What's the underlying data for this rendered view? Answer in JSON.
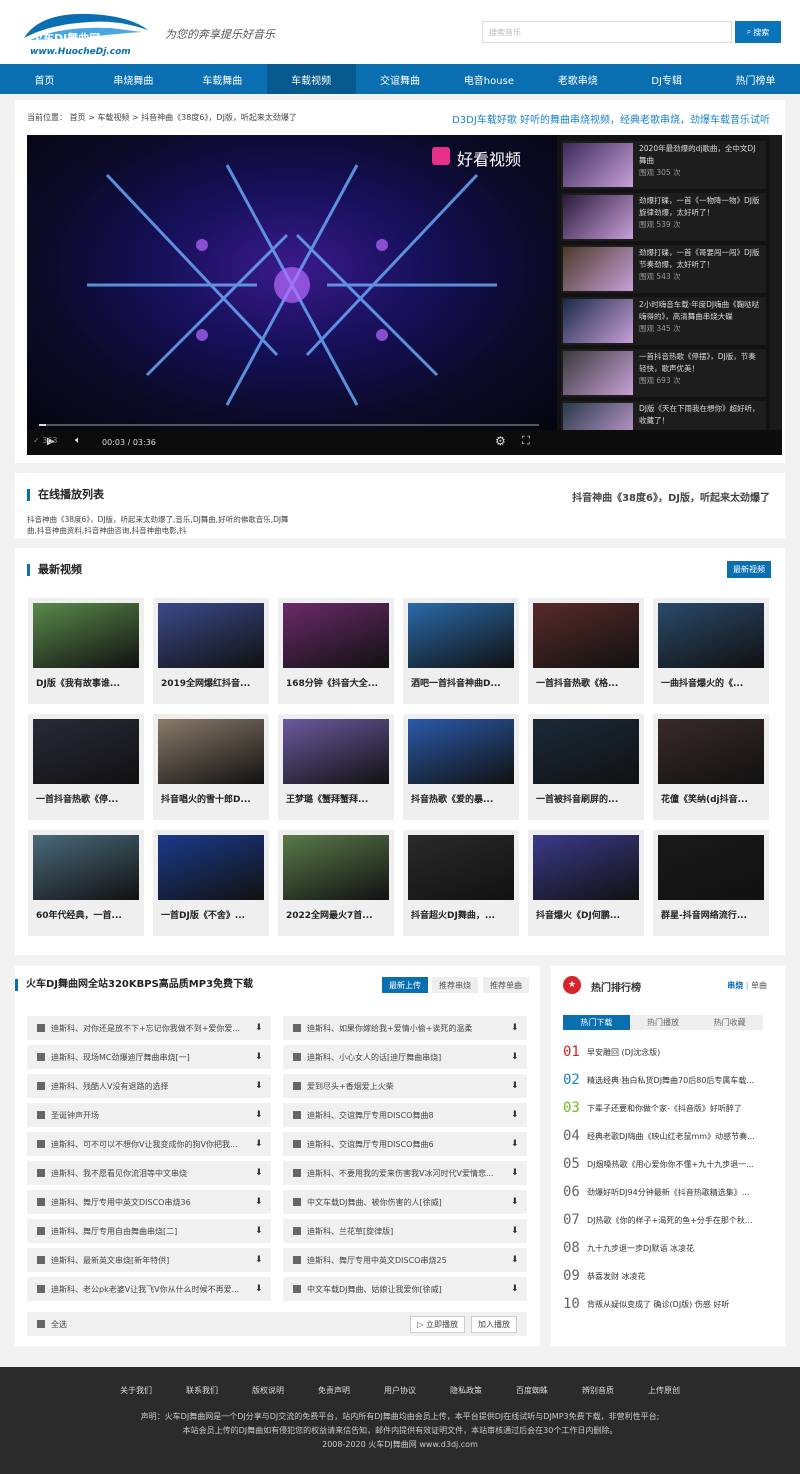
{
  "header": {
    "logo_text": "火车DJ舞曲网",
    "logo_sub": "www.HuocheDj.com",
    "slogan": "为您的奔享提乐好音乐",
    "search_placeholder": "搜索音乐",
    "search_button": "搜索"
  },
  "nav": [
    "首页",
    "串烧舞曲",
    "车载舞曲",
    "车载视频",
    "交谊舞曲",
    "电音house",
    "老歌串烧",
    "DJ专辑",
    "热门榜单"
  ],
  "nav_active": 3,
  "breadcrumb": {
    "prefix": "当前位置：",
    "items": [
      "首页",
      "车载视频",
      "抖音神曲《38度6》，DJ版，听起来太劲爆了"
    ]
  },
  "tagline": "D3DJ车载好歌 好听的舞曲串烧视频，经典老歌串烧，劲爆车载音乐试听",
  "player": {
    "brand": "好看视频",
    "time": "00:03 / 03:36",
    "views": "363",
    "progress": 0.014,
    "side": [
      {
        "title": "2020年最劲爆的dj歌曲，全中文DJ舞曲",
        "views": "围观 305 次"
      },
      {
        "title": "劲爆打碟，一首《一物降一物》DJ版旋律劲爆，太好听了！",
        "views": "围观 539 次"
      },
      {
        "title": "劲爆打碟，一首《哥要闯一闯》DJ版节奏劲爆，太好听了！",
        "views": "围观 543 次"
      },
      {
        "title": "2小时嗨音车载·年度DJ嗨曲《鞠哒哒嗨得的》，高清舞曲串烧大碟",
        "views": "围观 345 次"
      },
      {
        "title": "一首抖音热歌《停摆》，DJ版，节奏轻快，歌声优美！",
        "views": "围观 693 次"
      },
      {
        "title": "DJ版《天在下雨我在想你》超好听，收藏了！",
        "views": ""
      }
    ]
  },
  "playlist": {
    "title": "在线播放列表",
    "right": "抖音神曲《38度6》，DJ版，听起来太劲爆了",
    "desc": "抖音神曲《38度6》，DJ版，听起来太劲爆了,音乐,DJ舞曲,好听的佛歌音乐,DJ舞曲,抖音神曲资料,抖音神曲咨询,抖音神曲电影,抖"
  },
  "latest": {
    "title": "最新视频",
    "button": "最新视频",
    "cards": [
      "DJ版《我有故事谁...",
      "2019全网爆红抖音...",
      "168分钟《抖音大全...",
      "酒吧一首抖音神曲D...",
      "一首抖音热歌《格...",
      "一曲抖音爆火的《...",
      "一首抖音热歌《停...",
      "抖音唱火的雪十郎D...",
      "王梦璐《蟹拜蟹拜...",
      "抖音热歌《爱的暴...",
      "一首被抖音刷屏的...",
      "花僮《笑纳(dj抖音...",
      "60年代经典，一首...",
      "一首DJ版《不舍》...",
      "2022全网最火7首...",
      "抖音超火DJ舞曲，...",
      "抖音爆火《DJ何鹏...",
      "群星-抖音网络流行..."
    ]
  },
  "download": {
    "title": "火车DJ舞曲网全站320KBPS高品质MP3免费下载",
    "tabs": [
      "最新上传",
      "推荐串烧",
      "推荐单曲"
    ],
    "left": [
      "迪斯科、对你还是放不下+忘记你我做不到+爱你爱...",
      "迪斯科、现场MC劲爆迪厅舞曲串烧[一]",
      "迪斯科、残酷人V没有退路的选择",
      "圣诞钟声开场",
      "迪斯科、可不可以不想你V让我变成你的狗V你把我...",
      "迪斯科、我不愿看见你流泪等中文串烧",
      "迪斯科、舞厅专用中英文DISCO串烧36",
      "迪斯科、舞厅专用自由舞曲串烧[二]",
      "迪斯科、最新英文串烧[新年特供]",
      "迪斯科、老公pk老婆V让我飞V你从什么时候不再爱..."
    ],
    "right": [
      "迪斯科、如果你嫁给我+爱情小偷+诶死的温柔",
      "迪斯科、小心女人的话[迪厅舞曲串烧]",
      "爱到尽头+香烟爱上火柴",
      "迪斯科、交谊舞厅专用DISCO舞曲8",
      "迪斯科、交谊舞厅专用DISCO舞曲6",
      "迪斯科、不要用我的爱来伤害我V冰河时代V爱情悲...",
      "中文车载DJ舞曲、被你伤害的人[徐威]",
      "迪斯科、兰花草[旋律版]",
      "迪斯科、舞厅专用中英文DISCO串烧25",
      "中文车载DJ舞曲、姑娘让我爱你[徐威]"
    ],
    "select_all": "全选",
    "play_now": "▷ 立即播放",
    "add_play": "加入播放"
  },
  "ranking": {
    "title": "热门排行榜",
    "switch": [
      "串烧",
      "单曲"
    ],
    "tabs": [
      "热门下载",
      "热门播放",
      "热门收藏"
    ],
    "items": [
      {
        "n": "01",
        "t": "早安雕回 (DJ沈念版)"
      },
      {
        "n": "02",
        "t": "精选经典·独白私货DJ舞曲70后80后专属车载..."
      },
      {
        "n": "03",
        "t": "下辈子还要和你做个家-《抖音版》好听醉了"
      },
      {
        "n": "04",
        "t": "经典老歌DJ嗨曲《映山红老鼠mm》动感节奏..."
      },
      {
        "n": "05",
        "t": "DJ烟嗓热歌《用心爱你你不懂+九十九步退一..."
      },
      {
        "n": "06",
        "t": "劲爆好听DJ94分钟最新《抖音热歌精选集》..."
      },
      {
        "n": "07",
        "t": "DJ热歌《你的样子+渴死的鱼+分手在那个秋..."
      },
      {
        "n": "08",
        "t": "九十九步退一步DJ默语 冰凌花"
      },
      {
        "n": "09",
        "t": "恭喜发财 冰凌花"
      },
      {
        "n": "10",
        "t": "背叛从疑似变成了 确诊(DJ版) 伤感 好听"
      }
    ],
    "colors": [
      "#d9232a",
      "#1b83c9",
      "#6bbd1f"
    ]
  },
  "footer": {
    "links": [
      "关于我们",
      "联系我们",
      "版权说明",
      "免责声明",
      "用户协议",
      "隐私政策",
      "百度蜘蛛",
      "辨别音质",
      "上传原创"
    ],
    "note1": "声明：火车DJ舞曲网是一个DJ分享与DJ交流的免费平台，站内所有DJ舞曲均由会员上传，本平台提供DJ在线试听与DJMP3免费下载，非营利性平台;",
    "note2": "本站会员上传的DJ舞曲如有侵犯您的权益请来信告知，邮件内提供有效证明文件，本站审核通过后会在30个工作日内删除。",
    "copyright": "2008-2020 火车DJ舞曲网 www.d3dj.com"
  }
}
